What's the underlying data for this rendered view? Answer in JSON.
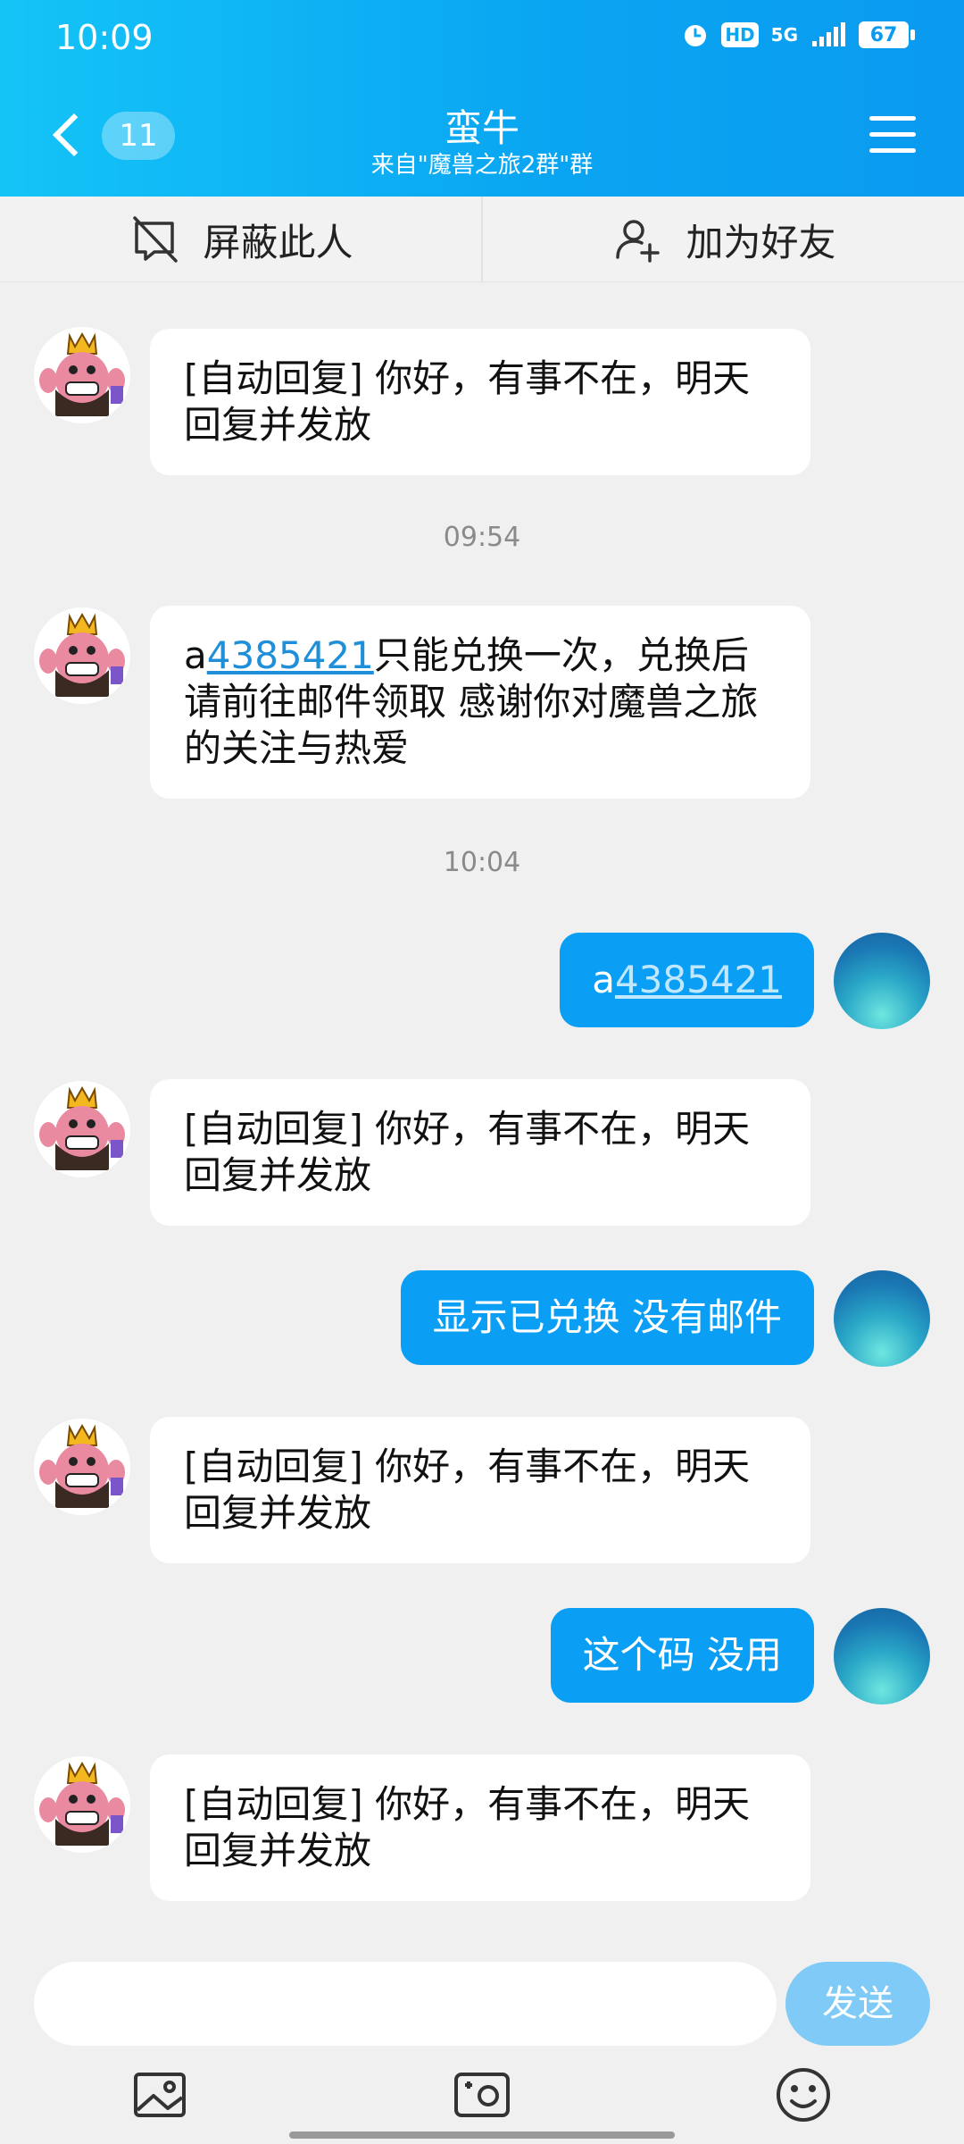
{
  "status_bar": {
    "time": "10:09",
    "icons": [
      "alarm-icon",
      "hd-icon",
      "5g-icon",
      "signal-icon"
    ],
    "hd_label": "HD",
    "net_label": "5G",
    "battery": "67"
  },
  "header": {
    "unread_count": "11",
    "title": "蛮牛",
    "subtitle": "来自\"魔兽之旅2群\"群",
    "background_colors": [
      "#14c4f7",
      "#0a9af0"
    ]
  },
  "action_bar": {
    "block_label": "屏蔽此人",
    "add_friend_label": "加为好友"
  },
  "messages": {
    "m1": "[自动回复] 你好，有事不在，明天回复并发放",
    "t1": "09:54",
    "m2_prefix": "a",
    "m2_link": "4385421",
    "m2_suffix": "只能兑换一次，兑换后请前往邮件领取 感谢你对魔兽之旅的关注与热爱",
    "t2": "10:04",
    "m3_prefix": "a",
    "m3_link": "4385421",
    "m4": "[自动回复] 你好，有事不在，明天回复并发放",
    "m5": "显示已兑换  没有邮件",
    "m6": "[自动回复] 你好，有事不在，明天回复并发放",
    "m7": "这个码 没用",
    "m8": "[自动回复] 你好，有事不在，明天回复并发放"
  },
  "composer": {
    "placeholder": "",
    "send_label": "发送"
  },
  "toolbar": {
    "icons": [
      "image-icon",
      "camera-icon",
      "emoji-icon"
    ]
  },
  "colors": {
    "accent": "#0a9ef4",
    "send_disabled": "#7fcaf6",
    "link": "#1e8fd8"
  }
}
